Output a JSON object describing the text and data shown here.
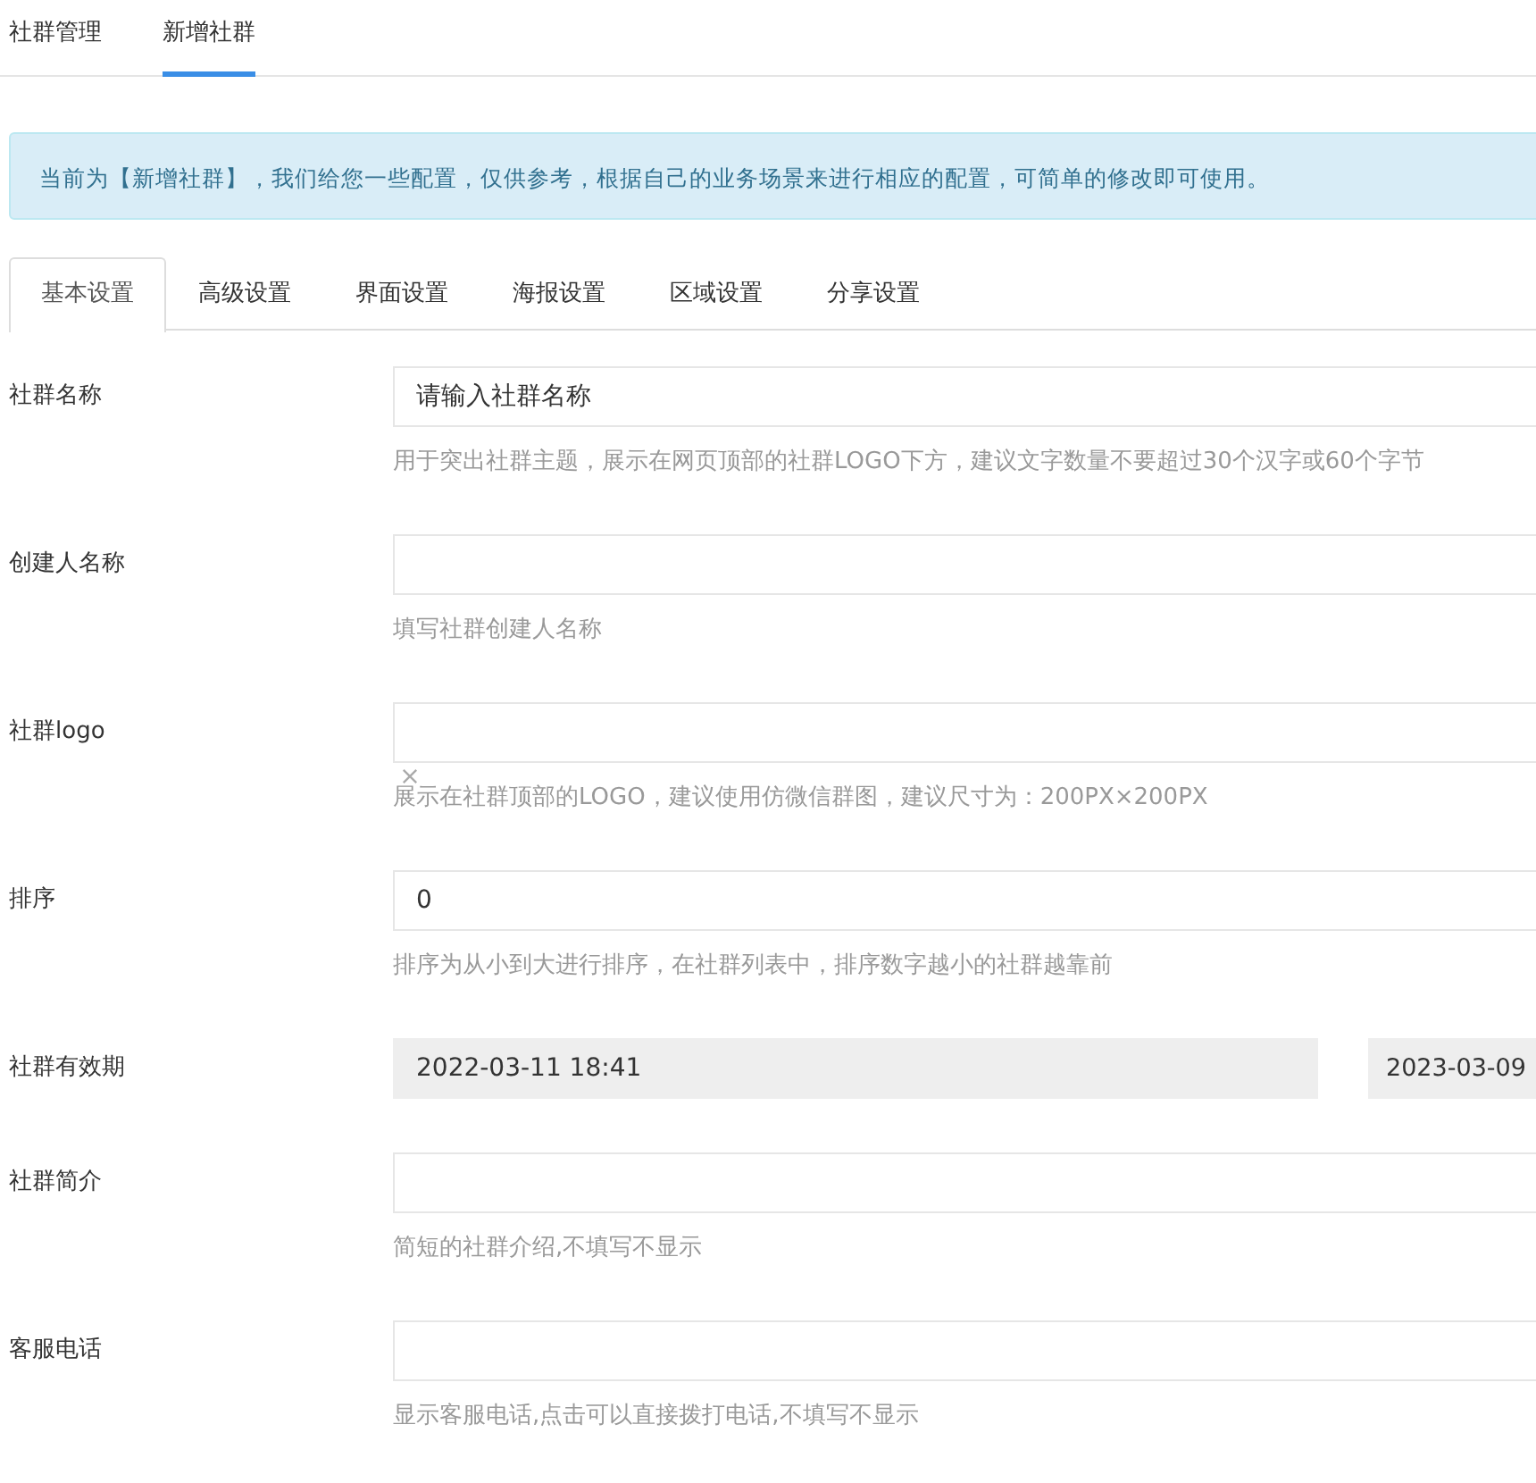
{
  "top_tabs": [
    {
      "label": "社群管理",
      "selected": false
    },
    {
      "label": "新增社群",
      "selected": true
    }
  ],
  "alert": "当前为【新增社群】，我们给您一些配置，仅供参考，根据自己的业务场景来进行相应的配置，可简单的修改即可使用。",
  "tabs": [
    {
      "label": "基本设置",
      "selected": true
    },
    {
      "label": "高级设置",
      "selected": false
    },
    {
      "label": "界面设置",
      "selected": false
    },
    {
      "label": "海报设置",
      "selected": false
    },
    {
      "label": "区域设置",
      "selected": false
    },
    {
      "label": "分享设置",
      "selected": false
    }
  ],
  "fields": [
    {
      "kind": "text",
      "label": "社群名称",
      "placeholder": "请输入社群名称",
      "help": "用于突出社群主题，展示在网页顶部的社群LOGO下方，建议文字数量不要超过30个汉字或60个字节"
    },
    {
      "kind": "text",
      "label": "创建人名称",
      "help": "填写社群创建人名称"
    },
    {
      "kind": "image",
      "label": "社群logo",
      "help": "展示在社群顶部的LOGO，建议使用仿微信群图，建议尺寸为：200PX×200PX"
    },
    {
      "kind": "text",
      "label": "排序",
      "value": "0",
      "help": "排序为从小到大进行排序，在社群列表中，排序数字越小的社群越靠前"
    },
    {
      "kind": "date_range",
      "label": "社群有效期",
      "start": "2022-03-11 18:41",
      "end": "2023-03-09"
    },
    {
      "kind": "text",
      "label": "社群简介",
      "help": "简短的社群介绍,不填写不显示"
    },
    {
      "kind": "text",
      "label": "客服电话",
      "help": "显示客服电话,点击可以直接拨打电话,不填写不显示"
    }
  ]
}
